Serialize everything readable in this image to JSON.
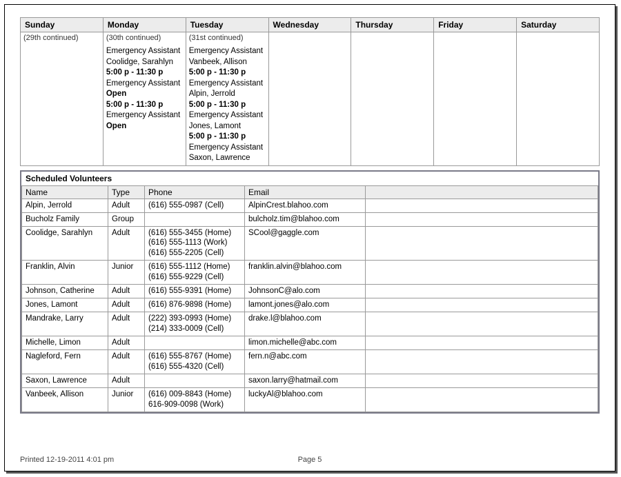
{
  "calendar": {
    "days": [
      {
        "header": "Sunday",
        "cont": "(29th continued)",
        "entries": []
      },
      {
        "header": "Monday",
        "cont": "(30th continued)",
        "entries": [
          {
            "text": "Emergency Assistant",
            "bold": false
          },
          {
            "text": "Coolidge, Sarahlyn",
            "bold": false
          },
          {
            "text": "5:00 p - 11:30 p",
            "bold": true
          },
          {
            "text": "Emergency Assistant",
            "bold": false
          },
          {
            "text": "Open",
            "bold": true
          },
          {
            "text": "5:00 p - 11:30 p",
            "bold": true
          },
          {
            "text": "Emergency Assistant",
            "bold": false
          },
          {
            "text": "Open",
            "bold": true
          }
        ]
      },
      {
        "header": "Tuesday",
        "cont": "(31st continued)",
        "entries": [
          {
            "text": "Emergency Assistant",
            "bold": false
          },
          {
            "text": "Vanbeek, Allison",
            "bold": false
          },
          {
            "text": "5:00 p - 11:30 p",
            "bold": true
          },
          {
            "text": "Emergency Assistant",
            "bold": false
          },
          {
            "text": "Alpin, Jerrold",
            "bold": false
          },
          {
            "text": "5:00 p - 11:30 p",
            "bold": true
          },
          {
            "text": "Emergency Assistant",
            "bold": false
          },
          {
            "text": "Jones, Lamont",
            "bold": false
          },
          {
            "text": "5:00 p - 11:30 p",
            "bold": true
          },
          {
            "text": "Emergency Assistant",
            "bold": false
          },
          {
            "text": "Saxon, Lawrence",
            "bold": false
          }
        ]
      },
      {
        "header": "Wednesday",
        "cont": "",
        "entries": []
      },
      {
        "header": "Thursday",
        "cont": "",
        "entries": []
      },
      {
        "header": "Friday",
        "cont": "",
        "entries": []
      },
      {
        "header": "Saturday",
        "cont": "",
        "entries": []
      }
    ]
  },
  "volunteers": {
    "title": "Scheduled Volunteers",
    "headers": {
      "name": "Name",
      "type": "Type",
      "phone": "Phone",
      "email": "Email"
    },
    "rows": [
      {
        "name": "Alpin, Jerrold",
        "type": "Adult",
        "phones": [
          "(616) 555-0987 (Cell)"
        ],
        "email": "AlpinCrest.blahoo.com"
      },
      {
        "name": "Bucholz Family",
        "type": "Group",
        "phones": [],
        "email": "bulcholz.tim@blahoo.com"
      },
      {
        "name": "Coolidge, Sarahlyn",
        "type": "Adult",
        "phones": [
          "(616) 555-3455 (Home)",
          "(616) 555-1113 (Work)",
          "(616) 555-2205 (Cell)"
        ],
        "email": "SCool@gaggle.com"
      },
      {
        "name": "Franklin, Alvin",
        "type": "Junior",
        "phones": [
          "(616) 555-1112 (Home)",
          "(616) 555-9229 (Cell)"
        ],
        "email": "franklin.alvin@blahoo.com"
      },
      {
        "name": "Johnson, Catherine",
        "type": "Adult",
        "phones": [
          "(616) 555-9391 (Home)"
        ],
        "email": "JohnsonC@alo.com"
      },
      {
        "name": "Jones, Lamont",
        "type": "Adult",
        "phones": [
          "(616) 876-9898 (Home)"
        ],
        "email": "lamont.jones@alo.com"
      },
      {
        "name": "Mandrake, Larry",
        "type": "Adult",
        "phones": [
          "(222) 393-0993 (Home)",
          "(214) 333-0009 (Cell)"
        ],
        "email": "drake.l@blahoo.com"
      },
      {
        "name": "Michelle, Limon",
        "type": "Adult",
        "phones": [],
        "email": "limon.michelle@abc.com"
      },
      {
        "name": "Nagleford, Fern",
        "type": "Adult",
        "phones": [
          "(616) 555-8767 (Home)",
          "(616) 555-4320 (Cell)"
        ],
        "email": "fern.n@abc.com"
      },
      {
        "name": "Saxon, Lawrence",
        "type": "Adult",
        "phones": [],
        "email": "saxon.larry@hatmail.com"
      },
      {
        "name": "Vanbeek, Allison",
        "type": "Junior",
        "phones": [
          "(616) 009-8843 (Home)",
          "616-909-0098 (Work)"
        ],
        "email": "luckyAl@blahoo.com"
      }
    ]
  },
  "footer": {
    "printed": "Printed 12-19-2011 4:01 pm",
    "page": "Page 5"
  }
}
